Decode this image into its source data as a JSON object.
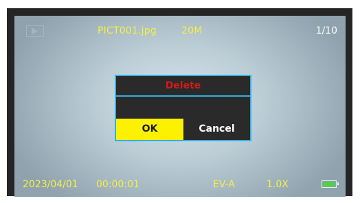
{
  "top_bar": {
    "filename": "PICT001.jpg",
    "resolution": "20M",
    "counter": "1/10"
  },
  "mode_icon": "play-icon",
  "dialog": {
    "title": "Delete",
    "ok_label": "OK",
    "cancel_label": "Cancel"
  },
  "bottom_bar": {
    "date": "2023/04/01",
    "time": "00:00:01",
    "ev": "EV-A",
    "zoom": "1.0X",
    "battery_icon": "battery-full-icon"
  },
  "colors": {
    "info_text": "#f5ef45",
    "dialog_border": "#31b2e4",
    "delete_title": "#d11a1a",
    "selected_button": "#fbf100",
    "battery": "#4fd14a"
  }
}
